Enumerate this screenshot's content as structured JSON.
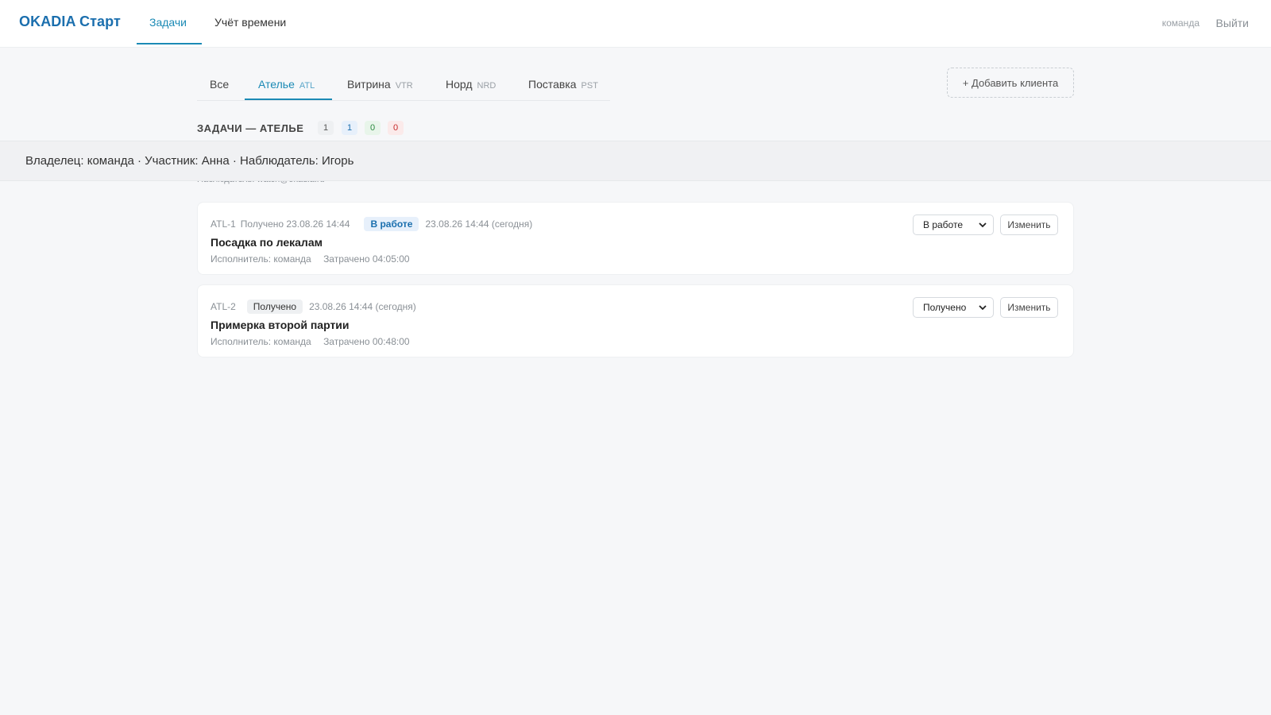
{
  "header": {
    "brand": "OKADIA Старт",
    "nav": [
      {
        "label": "Задачи",
        "active": true
      },
      {
        "label": "Учёт времени",
        "active": false
      }
    ],
    "user": "команда",
    "logout": "Выйти"
  },
  "tabs": [
    {
      "label": "Все",
      "code": ""
    },
    {
      "label": "Ателье",
      "code": "ATL",
      "active": true
    },
    {
      "label": "Витрина",
      "code": "VTR"
    },
    {
      "label": "Норд",
      "code": "NRD"
    },
    {
      "label": "Поставка",
      "code": "PST"
    }
  ],
  "add_client_label": "+ Добавить клиента",
  "section": {
    "title": "ЗАДАЧИ — АТЕЛЬЕ",
    "counts": [
      "1",
      "1",
      "0",
      "0"
    ]
  },
  "hidden_observer_text": "Наблюдатель: watch@okadia.ru",
  "tooltip": "Владелец: команда · Участник: Анна · Наблюдатель: Игорь",
  "tasks": [
    {
      "id": "ATL-1",
      "received": "Получено 23.08.26 14:44",
      "status_badge": "В работе",
      "status_time": "23.08.26 14:44 (сегодня)",
      "title": "Посадка по лекалам",
      "assignee": "Исполнитель: команда",
      "spent": "Затрачено 04:05:00",
      "select_value": "В работе",
      "edit_label": "Изменить"
    },
    {
      "id": "ATL-2",
      "received": "",
      "status_badge": "Получено",
      "status_time": "23.08.26 14:44 (сегодня)",
      "title": "Примерка второй партии",
      "assignee": "Исполнитель: команда",
      "spent": "Затрачено 00:48:00",
      "select_value": "Получено",
      "edit_label": "Изменить"
    }
  ],
  "colors": {
    "accent": "#1b8ab5",
    "brand": "#1b6fae",
    "background": "#f6f7f9"
  }
}
